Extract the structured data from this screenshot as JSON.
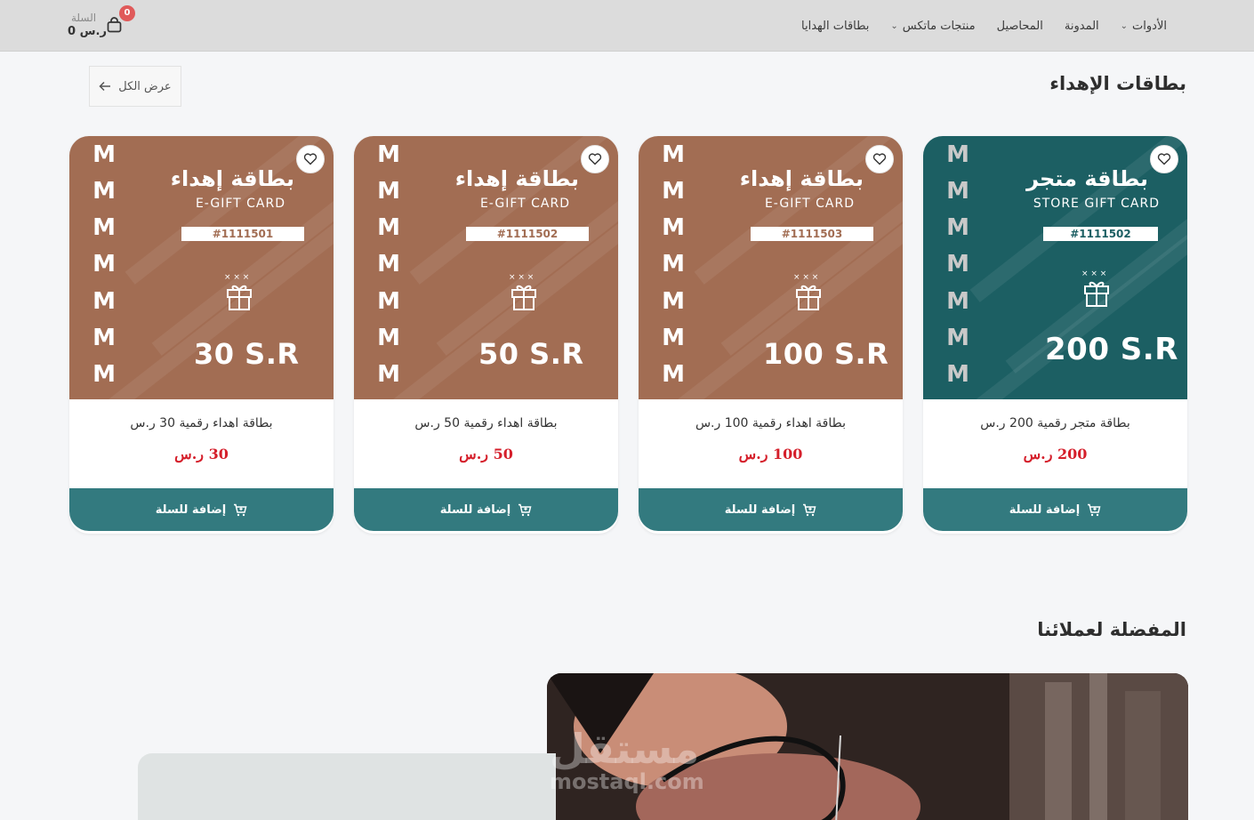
{
  "nav": {
    "items": [
      {
        "label": "الأدوات",
        "has_dropdown": true
      },
      {
        "label": "المدونة",
        "has_dropdown": false
      },
      {
        "label": "المحاصيل",
        "has_dropdown": false
      },
      {
        "label": "منتجات ماتكس",
        "has_dropdown": true
      },
      {
        "label": "بطاقات الهدايا",
        "has_dropdown": false
      }
    ]
  },
  "cart": {
    "label": "السلة",
    "total": "0 ر.س",
    "count": "0",
    "badge_color": "#e05a5a"
  },
  "gift_section": {
    "title": "بطاقات الإهداء",
    "view_all": "عرض الكل"
  },
  "products": [
    {
      "theme": "teal",
      "card_title": "بطاقة متجر",
      "card_subtitle": "STORE GIFT CARD",
      "code": "#1111502",
      "amount_label": "200 S.R",
      "name": "بطاقة متجر رقمية 200 ر.س",
      "price": "200 ر.س",
      "button": "إضافة للسلة"
    },
    {
      "theme": "brown",
      "card_title": "بطاقة إهداء",
      "card_subtitle": "E-GIFT CARD",
      "code": "#1111503",
      "amount_label": "100 S.R",
      "name": "بطاقة اهداء رقمية 100 ر.س",
      "price": "100 ر.س",
      "button": "إضافة للسلة"
    },
    {
      "theme": "brown",
      "card_title": "بطاقة إهداء",
      "card_subtitle": "E-GIFT CARD",
      "code": "#1111502",
      "amount_label": "50 S.R",
      "name": "بطاقة اهداء رقمية 50 ر.س",
      "price": "50 ر.س",
      "button": "إضافة للسلة"
    },
    {
      "theme": "brown",
      "card_title": "بطاقة إهداء",
      "card_subtitle": "E-GIFT CARD",
      "code": "#1111501",
      "amount_label": "30 S.R",
      "name": "بطاقة اهداء رقمية 30 ر.س",
      "price": "30 ر.س",
      "button": "إضافة للسلة"
    }
  ],
  "favorites_section": {
    "title": "المفضلة لعملائنا"
  },
  "watermark": {
    "ar": "مستقل",
    "en": "mostaql.com"
  },
  "colors": {
    "brown_card": "#a26d53",
    "teal_card": "#1c5f63",
    "button": "#337a7f",
    "price": "#d51f2b"
  }
}
